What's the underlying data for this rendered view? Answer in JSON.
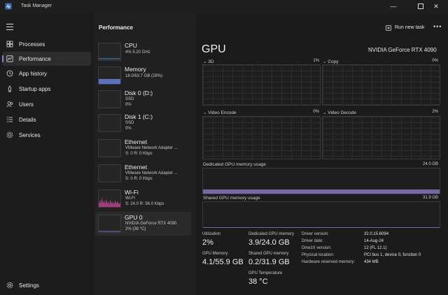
{
  "window": {
    "title": "Task Manager"
  },
  "nav": {
    "items": [
      {
        "label": "Processes",
        "icon": "processes-icon"
      },
      {
        "label": "Performance",
        "icon": "performance-icon"
      },
      {
        "label": "App history",
        "icon": "app-history-icon"
      },
      {
        "label": "Startup apps",
        "icon": "startup-apps-icon"
      },
      {
        "label": "Users",
        "icon": "users-icon"
      },
      {
        "label": "Details",
        "icon": "details-icon"
      },
      {
        "label": "Services",
        "icon": "services-icon"
      }
    ],
    "settings": "Settings"
  },
  "header": {
    "section": "Performance",
    "run_new_task": "Run new task",
    "more": "•••"
  },
  "devices": [
    {
      "name": "CPU",
      "line1": "4% 5.20 GHz",
      "line2": "",
      "line3": ""
    },
    {
      "name": "Memory",
      "line1": "18.0/63.7 GB (28%)",
      "line2": "",
      "line3": ""
    },
    {
      "name": "Disk 0 (D:)",
      "line1": "SSD",
      "line2": "0%",
      "line3": ""
    },
    {
      "name": "Disk 1 (C:)",
      "line1": "SSD",
      "line2": "0%",
      "line3": ""
    },
    {
      "name": "Ethernet",
      "line1": "VMware Network Adapter ...",
      "line2": "S: 0 R: 0 Kbps",
      "line3": ""
    },
    {
      "name": "Ethernet",
      "line1": "VMware Network Adapter ...",
      "line2": "S: 0 R: 0 Kbps",
      "line3": ""
    },
    {
      "name": "Wi-Fi",
      "line1": "Wi-Fi",
      "line2": "S: 24.0 R: 56.0 Kbps",
      "line3": ""
    },
    {
      "name": "GPU 0",
      "line1": "NVIDIA GeForce RTX 4090",
      "line2": "2% (38 °C)",
      "line3": ""
    }
  ],
  "gpu": {
    "title": "GPU",
    "model": "NVIDIA GeForce RTX 4090",
    "engines": [
      {
        "label": "3D",
        "pct": "1%"
      },
      {
        "label": "Copy",
        "pct": "0%"
      },
      {
        "label": "Video Encode",
        "pct": "0%"
      },
      {
        "label": "Video Decode",
        "pct": "2%"
      }
    ],
    "dedicated_label": "Dedicated GPU memory usage",
    "dedicated_max": "24.0 GB",
    "dedicated_fill": 0.16,
    "shared_label": "Shared GPU memory usage",
    "shared_max": "31.9 GB",
    "shared_fill": 0.006
  },
  "stats": {
    "utilization_label": "Utilization",
    "utilization": "2%",
    "dedicated_mem_label": "Dedicated GPU memory",
    "dedicated_mem": "3.9/24.0 GB",
    "gpu_mem_label": "GPU Memory",
    "gpu_mem": "4.1/55.9 GB",
    "shared_mem_label": "Shared GPU memory",
    "shared_mem": "0.2/31.9 GB",
    "temp_label": "GPU Temperature",
    "temp": "38 °C"
  },
  "info": [
    {
      "k": "Driver version:",
      "v": "32.0.15.6094"
    },
    {
      "k": "Driver date:",
      "v": "14-Aug-24"
    },
    {
      "k": "DirectX version:",
      "v": "12 (FL 12.1)"
    },
    {
      "k": "Physical location:",
      "v": "PCI bus 1, device 0, function 0"
    },
    {
      "k": "Hardware reserved memory:",
      "v": "434 MB"
    }
  ],
  "colors": {
    "accent": "#9e7bd8",
    "gpu_fill": "#7a64a8"
  }
}
